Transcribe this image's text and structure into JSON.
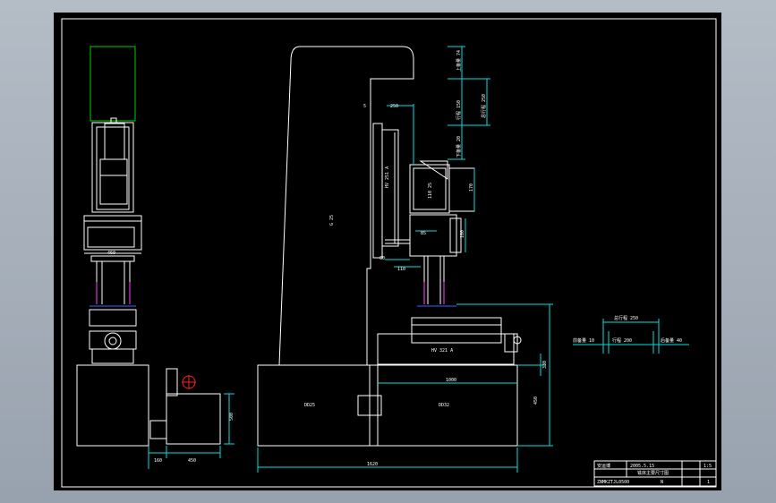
{
  "colors": {
    "background": "#000000",
    "frame": "#ffffff",
    "line": "#ffffff",
    "dimension": "#00e0e0",
    "accent_green": "#00d000",
    "accent_magenta": "#ff40ff",
    "accent_blue": "#4060ff",
    "accent_red": "#ff2020"
  },
  "labels": {
    "column": "G 25",
    "motor_vertical": "HV 251 A",
    "motor_head": "110 25",
    "motor_table": "HV 321 A",
    "cabinet_left": "DD25",
    "cabinet_right": "DD32",
    "head_dim": "250",
    "head_offset": "5",
    "head_w": "170",
    "head_lower": "100",
    "spindle_gap": "85",
    "spindle_small": "60",
    "spindle_base": "110",
    "side_width": "460",
    "side_base_a": "160",
    "side_base_b": "450",
    "side_height": "500",
    "bed_len": "1000",
    "total_len": "1620",
    "h_upper": "330",
    "h_lower": "450",
    "v_up": "上备量 74",
    "v_travel_a": "行程 150",
    "v_travel_b": "总行程 250",
    "v_down": "下备量 20",
    "travel_total": "总行程 250",
    "travel_front": "前备量 10",
    "travel_mid": "行程 200",
    "travel_back": "后备量 40"
  },
  "title_block": {
    "company": "安运博",
    "date": "2005.5.15",
    "drawing": "铣床主要尺寸图",
    "scale": "1:5",
    "sheet": "1",
    "subtitle": "ZNMKZTJL0500",
    "code": "N"
  }
}
